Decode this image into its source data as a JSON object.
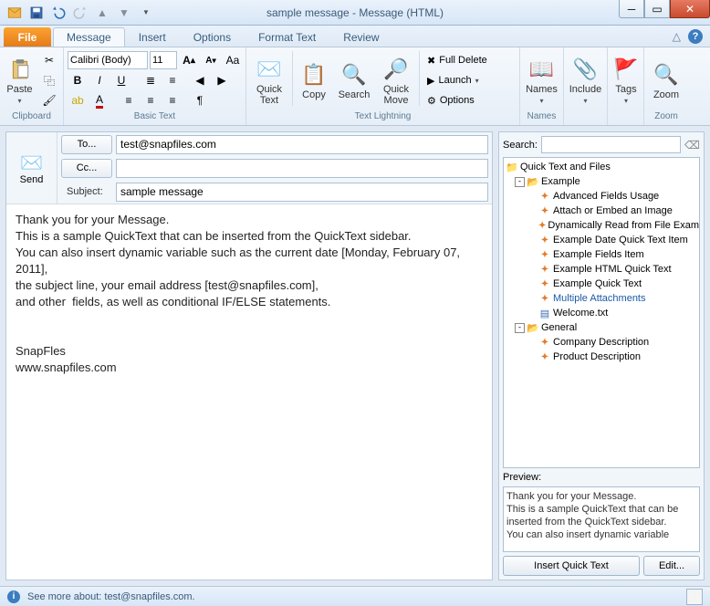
{
  "window": {
    "title": "sample message  -  Message (HTML)"
  },
  "tabs": {
    "file": "File",
    "items": [
      "Message",
      "Insert",
      "Options",
      "Format Text",
      "Review"
    ]
  },
  "ribbon": {
    "clipboard": {
      "paste": "Paste",
      "label": "Clipboard"
    },
    "basictext": {
      "font": "Calibri (Body)",
      "size": "11",
      "label": "Basic Text"
    },
    "textlightning": {
      "quicktext": "Quick\nText",
      "copy": "Copy",
      "search": "Search",
      "quickmove": "Quick\nMove",
      "fulldelete": "Full Delete",
      "launch": "Launch",
      "options": "Options",
      "label": "Text Lightning"
    },
    "names": {
      "label": "Names",
      "btn": "Names"
    },
    "include": {
      "btn": "Include"
    },
    "tags": {
      "btn": "Tags"
    },
    "zoom": {
      "btn": "Zoom",
      "label": "Zoom"
    }
  },
  "compose": {
    "send": "Send",
    "to_btn": "To...",
    "cc_btn": "Cc...",
    "subject_label": "Subject:",
    "to_value": "test@snapfiles.com",
    "cc_value": "",
    "subject_value": "sample message",
    "body": "Thank you for your Message.\nThis is a sample QuickText that can be inserted from the QuickText sidebar.\nYou can also insert dynamic variable such as the current date [Monday, February 07, 2011],\nthe subject line, your email address [test@snapfiles.com],\nand other  fields, as well as conditional IF/ELSE statements.\n\n\nSnapFles\nwww.snapfiles.com"
  },
  "sidebar": {
    "search_label": "Search:",
    "root": "Quick Text and Files",
    "example": "Example",
    "example_items": [
      "Advanced Fields Usage",
      "Attach or Embed an Image",
      "Dynamically Read from File Exam",
      "Example Date Quick Text Item",
      "Example Fields Item",
      "Example HTML Quick Text",
      "Example Quick Text",
      "Multiple Attachments",
      "Welcome.txt"
    ],
    "general": "General",
    "general_items": [
      "Company Description",
      "Product Description"
    ],
    "preview_label": "Preview:",
    "preview_text": "Thank you for your Message.\nThis is a sample QuickText that can be inserted from the QuickText sidebar.\nYou can also insert dynamic variable",
    "insert_btn": "Insert Quick Text",
    "edit_btn": "Edit..."
  },
  "status": {
    "text": "See more about: test@snapfiles.com."
  }
}
